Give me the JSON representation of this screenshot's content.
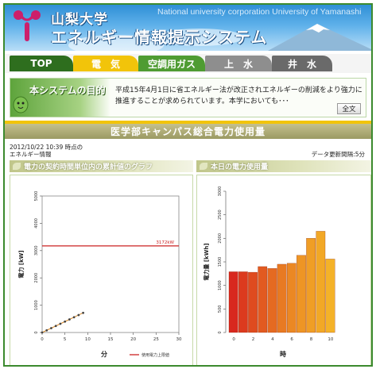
{
  "header": {
    "university": "山梨大学",
    "system": "エネルギー情報提示システム",
    "english": "National university corporation University of Yamanashi"
  },
  "nav": {
    "tabs": [
      {
        "label": "TOP"
      },
      {
        "label": "電　気"
      },
      {
        "label": "空調用ガス"
      },
      {
        "label": "上　水"
      },
      {
        "label": "井　水"
      }
    ],
    "active": 1
  },
  "intro": {
    "badge": "本システムの目的",
    "text": "平成15年4月1日に省エネルギー法が改正されエネルギーの削減をより強力に推進することが求められています。本学においても･･･",
    "more_label": "全文"
  },
  "page_title": "医学部キャンパス総合電力使用量",
  "datetime": {
    "line1": "2012/10/22 10:39 時点の",
    "line2": "エネルギー情報"
  },
  "update_interval": "データ更新間隔:5分",
  "panels": {
    "left_title": "電力の契約時間単位内の累計値のグラフ",
    "right_title": "本日の電力使用量"
  },
  "colors": {
    "frame": "#3c8a2e",
    "nav_active": "#f2c40a",
    "contract_line": "#cc2222",
    "cumulative_line": "#d98a2a"
  },
  "chart_data": [
    {
      "type": "line",
      "ylabel": "電力 [kW]",
      "xlabel": "分",
      "ylim": [
        0,
        5000
      ],
      "xlim": [
        0,
        30
      ],
      "yticks": [
        0,
        1000,
        2000,
        3000,
        4000,
        5000
      ],
      "xticks": [
        0,
        5,
        10,
        15,
        20,
        25,
        30
      ],
      "contract_value": 3172,
      "contract_label": "3172kW",
      "legend": "使用電力上限値",
      "series": [
        {
          "x": [
            0,
            1,
            2,
            3,
            4,
            5,
            6,
            7,
            8,
            9
          ],
          "values": [
            0,
            80,
            160,
            240,
            320,
            400,
            480,
            560,
            640,
            720
          ]
        }
      ]
    },
    {
      "type": "bar",
      "ylabel": "電力量 [kWh]",
      "xlabel": "時",
      "ylim": [
        0,
        3000
      ],
      "yticks": [
        0,
        500,
        1000,
        1500,
        2000,
        2500,
        3000
      ],
      "categories": [
        0,
        1,
        2,
        3,
        4,
        5,
        6,
        7,
        8,
        9,
        10
      ],
      "category_labels": [
        "0",
        "",
        "2",
        "",
        "4",
        "",
        "6",
        "",
        "8",
        "",
        "10"
      ],
      "values": [
        1290,
        1290,
        1280,
        1400,
        1360,
        1450,
        1470,
        1640,
        2000,
        2150,
        1560
      ],
      "colors": [
        "#d8281e",
        "#dc3a1e",
        "#df4b1f",
        "#e25a20",
        "#e56a21",
        "#e87a22",
        "#eb8823",
        "#ee9524",
        "#f09e25",
        "#f2a826",
        "#f4b228"
      ]
    }
  ]
}
